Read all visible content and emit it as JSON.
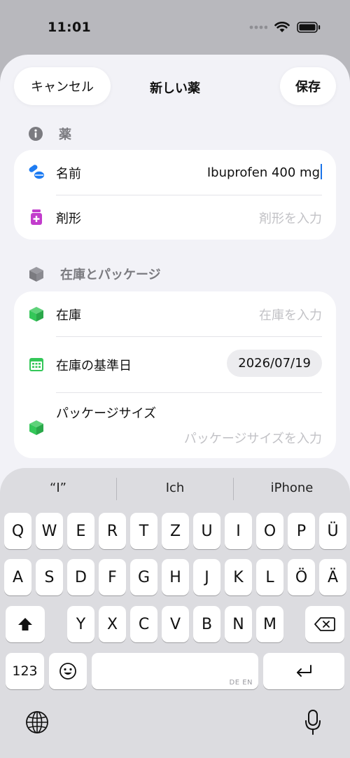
{
  "status_bar": {
    "time": "11:01"
  },
  "nav": {
    "cancel_label": "キャンセル",
    "title": "新しい薬",
    "save_label": "保存"
  },
  "sections": {
    "medicine": {
      "header": "薬",
      "name_label": "名前",
      "name_value": "Ibuprofen 400 mg",
      "form_label": "剤形",
      "form_placeholder": "剤形を入力"
    },
    "stock": {
      "header": "在庫とパッケージ",
      "stock_label": "在庫",
      "stock_placeholder": "在庫を入力",
      "base_date_label": "在庫の基準日",
      "base_date_value": "2026/07/19",
      "package_label": "パッケージサイズ",
      "package_placeholder": "パッケージサイズを入力"
    }
  },
  "keyboard": {
    "suggestions": [
      "“I”",
      "Ich",
      "iPhone"
    ],
    "row1": [
      "Q",
      "W",
      "E",
      "R",
      "T",
      "Z",
      "U",
      "I",
      "O",
      "P",
      "Ü"
    ],
    "row2": [
      "A",
      "S",
      "D",
      "F",
      "G",
      "H",
      "J",
      "K",
      "L",
      "Ö",
      "Ä"
    ],
    "row3": [
      "Y",
      "X",
      "C",
      "V",
      "B",
      "N",
      "M"
    ],
    "numbers_label": "123",
    "space_tag": "DE EN"
  },
  "colors": {
    "accent_blue": "#1a73e8",
    "pill_icon": "#1e7cf2",
    "bottle_icon": "#c23ccc",
    "box_icon": "#34c759",
    "calendar_icon": "#34c759",
    "section_icon": "#7b7b80"
  }
}
